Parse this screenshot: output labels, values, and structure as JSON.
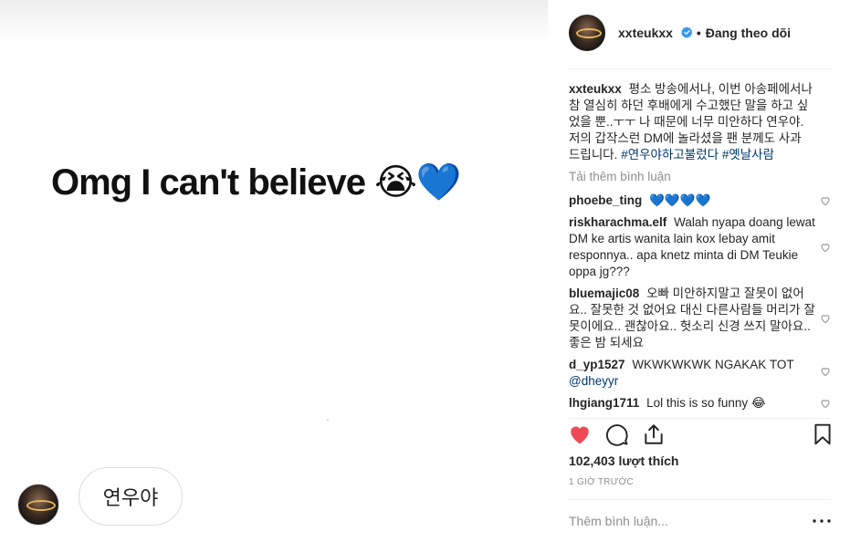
{
  "media": {
    "headline_text": "Omg I can't believe ",
    "headline_emoji": "😭💙",
    "bubble_text": "연우야"
  },
  "post": {
    "username": "xxteukxx",
    "follow_status": "Đang theo dõi",
    "separator": "•",
    "caption_text": "평소 방송에서나, 이번 아송페에서나 참 열심히 하던 후배에게 수고했단 말을 하고 싶었을 뿐..ㅜㅜ 나 때문에 너무 미안하다 연우야. 저의 갑작스런 DM에 놀라셨을 팬 분께도 사과 드립니다.",
    "caption_tags": "#연우야하고불렀다 #옛날사람",
    "load_more": "Tải thêm bình luận",
    "likes": "102,403 lượt thích",
    "time": "1 GIỜ TRƯỚC",
    "add_comment_placeholder": "Thêm bình luận..."
  },
  "comments": [
    {
      "user": "phoebe_ting",
      "text": "💙💙💙💙"
    },
    {
      "user": "riskharachma.elf",
      "text": "Walah nyapa doang lewat DM ke artis wanita lain kox lebay amit responnya.. apa knetz minta di DM Teukie oppa jg???"
    },
    {
      "user": "bluemajic08",
      "text": "오빠 미안하지말고 잘못이 없어요.. 잘못한 것 없어요 대신 다른사람들 머리가 잘못이에요.. 괜찮아요.. 헛소리 신경 쓰지 말아요.. 좋은 밤 되세요"
    },
    {
      "user": "d_yp1527",
      "text": "WKWKWKWK NGAKAK TOT",
      "mention": "@dheyyr"
    },
    {
      "user": "lhgiang1711",
      "text": "Lol this is so funny 😂"
    }
  ],
  "icons": {
    "like": "heart-filled-icon",
    "comment": "comment-bubble-icon",
    "share": "share-icon",
    "save": "bookmark-icon",
    "comment_like": "heart-outline-icon",
    "more": "more-dots-icon",
    "verified": "verified-badge-icon"
  },
  "colors": {
    "like_red": "#ed4956",
    "verified_blue": "#3897f0",
    "secondary_text": "#8e8e8e",
    "hashtag": "#00376b"
  }
}
